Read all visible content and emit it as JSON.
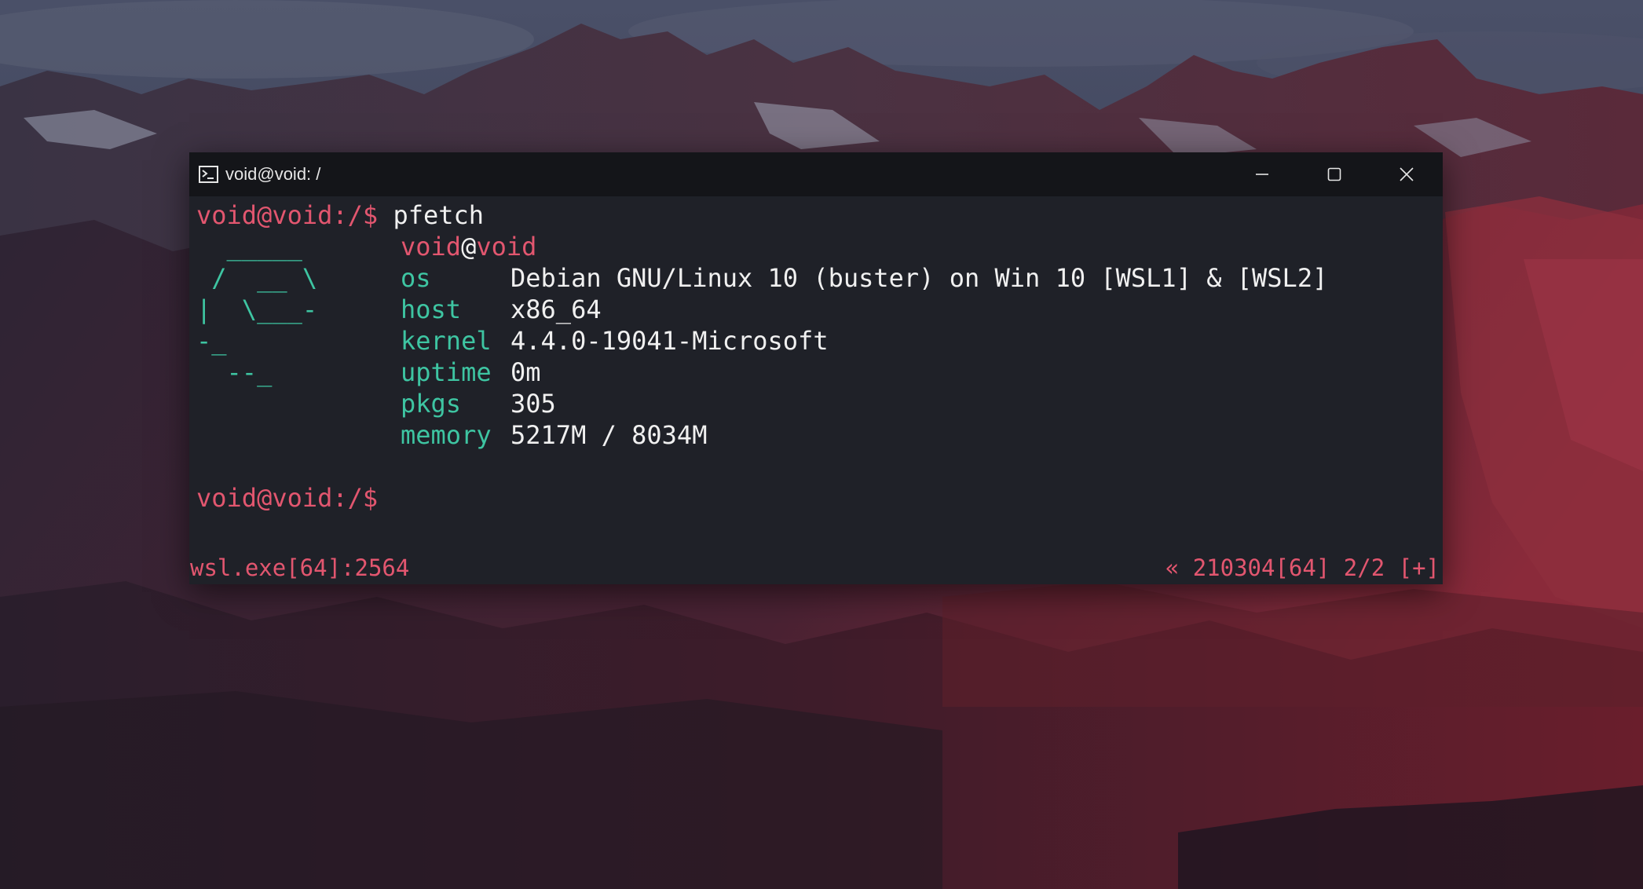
{
  "window": {
    "title": "void@void: /",
    "controls": {
      "minimize_icon": "minimize-icon",
      "maximize_icon": "maximize-icon",
      "close_icon": "close-icon"
    }
  },
  "terminal": {
    "prompt": "void@void:/$",
    "command": " pfetch",
    "fetch": {
      "user": "void",
      "at": "@",
      "host_name": "void",
      "art": [
        "  _____",
        " /  __ \\",
        "|  \\___-",
        "-_",
        "  --_"
      ],
      "rows": [
        {
          "key": "os",
          "value": "Debian GNU/Linux 10 (buster) on Win 10 [WSL1] & [WSL2]"
        },
        {
          "key": "host",
          "value": "x86_64"
        },
        {
          "key": "kernel",
          "value": "4.4.0-19041-Microsoft"
        },
        {
          "key": "uptime",
          "value": "0m"
        },
        {
          "key": "pkgs",
          "value": "305"
        },
        {
          "key": "memory",
          "value": "5217M / 8034M"
        }
      ]
    },
    "prompt_second": "void@void:/$"
  },
  "status": {
    "left": "wsl.exe[64]:2564",
    "right": "« 210304[64] 2/2 [+]"
  },
  "colors": {
    "accent_pink": "#e2566f",
    "accent_green": "#3ec5a2",
    "terminal_bg": "#1f2128",
    "titlebar_bg": "#141519"
  }
}
